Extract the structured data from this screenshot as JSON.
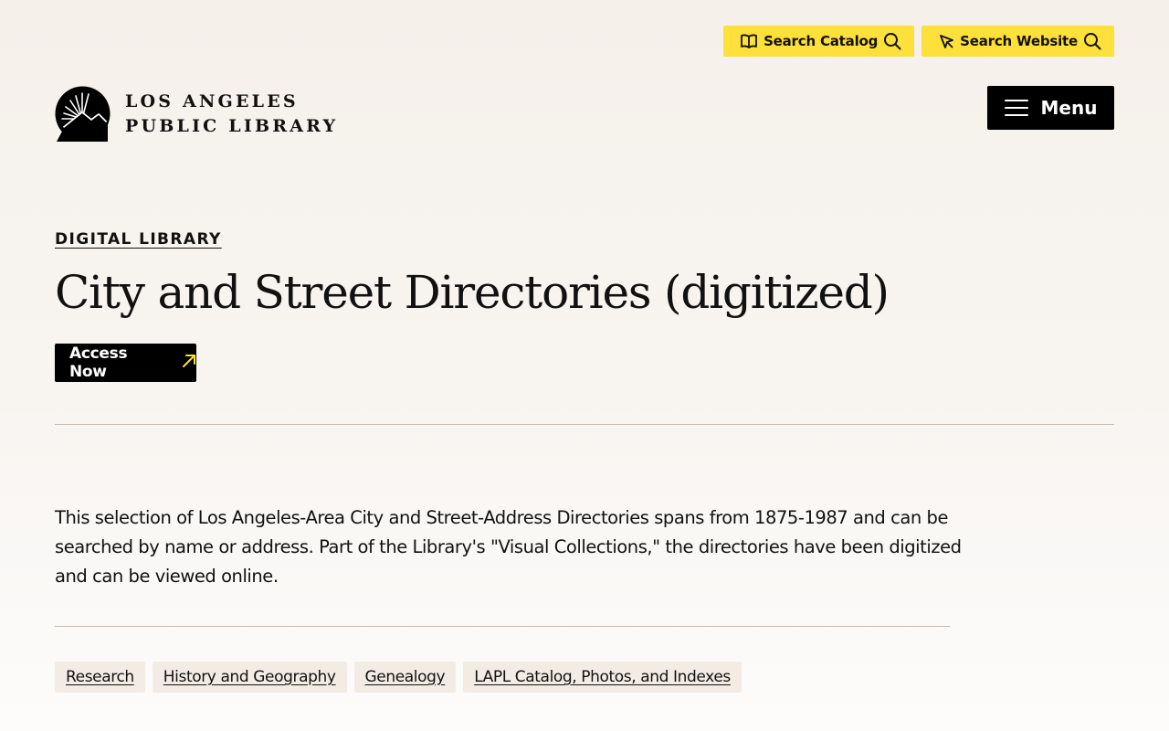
{
  "colors": {
    "accent_yellow": "#fde03a",
    "black": "#000000",
    "divider": "#cbb9ac",
    "tag_bg": "#f3ece5",
    "background": "#f5f0ea"
  },
  "utility": {
    "search_catalog": {
      "label": "Search Catalog",
      "icon": "open-book-icon",
      "trailing_icon": "search-icon"
    },
    "search_website": {
      "label": "Search Website",
      "icon": "cursor-arrow-icon",
      "trailing_icon": "search-icon"
    }
  },
  "logo": {
    "line1": "LOS ANGELES",
    "line2": "PUBLIC LIBRARY",
    "icon": "lapl-logo-mark"
  },
  "menu": {
    "label": "Menu",
    "icon": "hamburger-icon"
  },
  "hero": {
    "eyebrow": "DIGITAL LIBRARY",
    "title": "City and Street Directories (digitized)",
    "access_button": {
      "label": "Access Now",
      "icon": "external-arrow-icon"
    }
  },
  "description": "This selection of Los Angeles-Area City and Street-Address Directories spans from 1875-1987 and can be searched by name or address. Part of the Library's \"Visual Collections,\" the directories have been digitized and can be viewed online.",
  "tags": [
    {
      "label": "Research"
    },
    {
      "label": "History and Geography"
    },
    {
      "label": "Genealogy"
    },
    {
      "label": "LAPL Catalog, Photos, and Indexes"
    }
  ]
}
